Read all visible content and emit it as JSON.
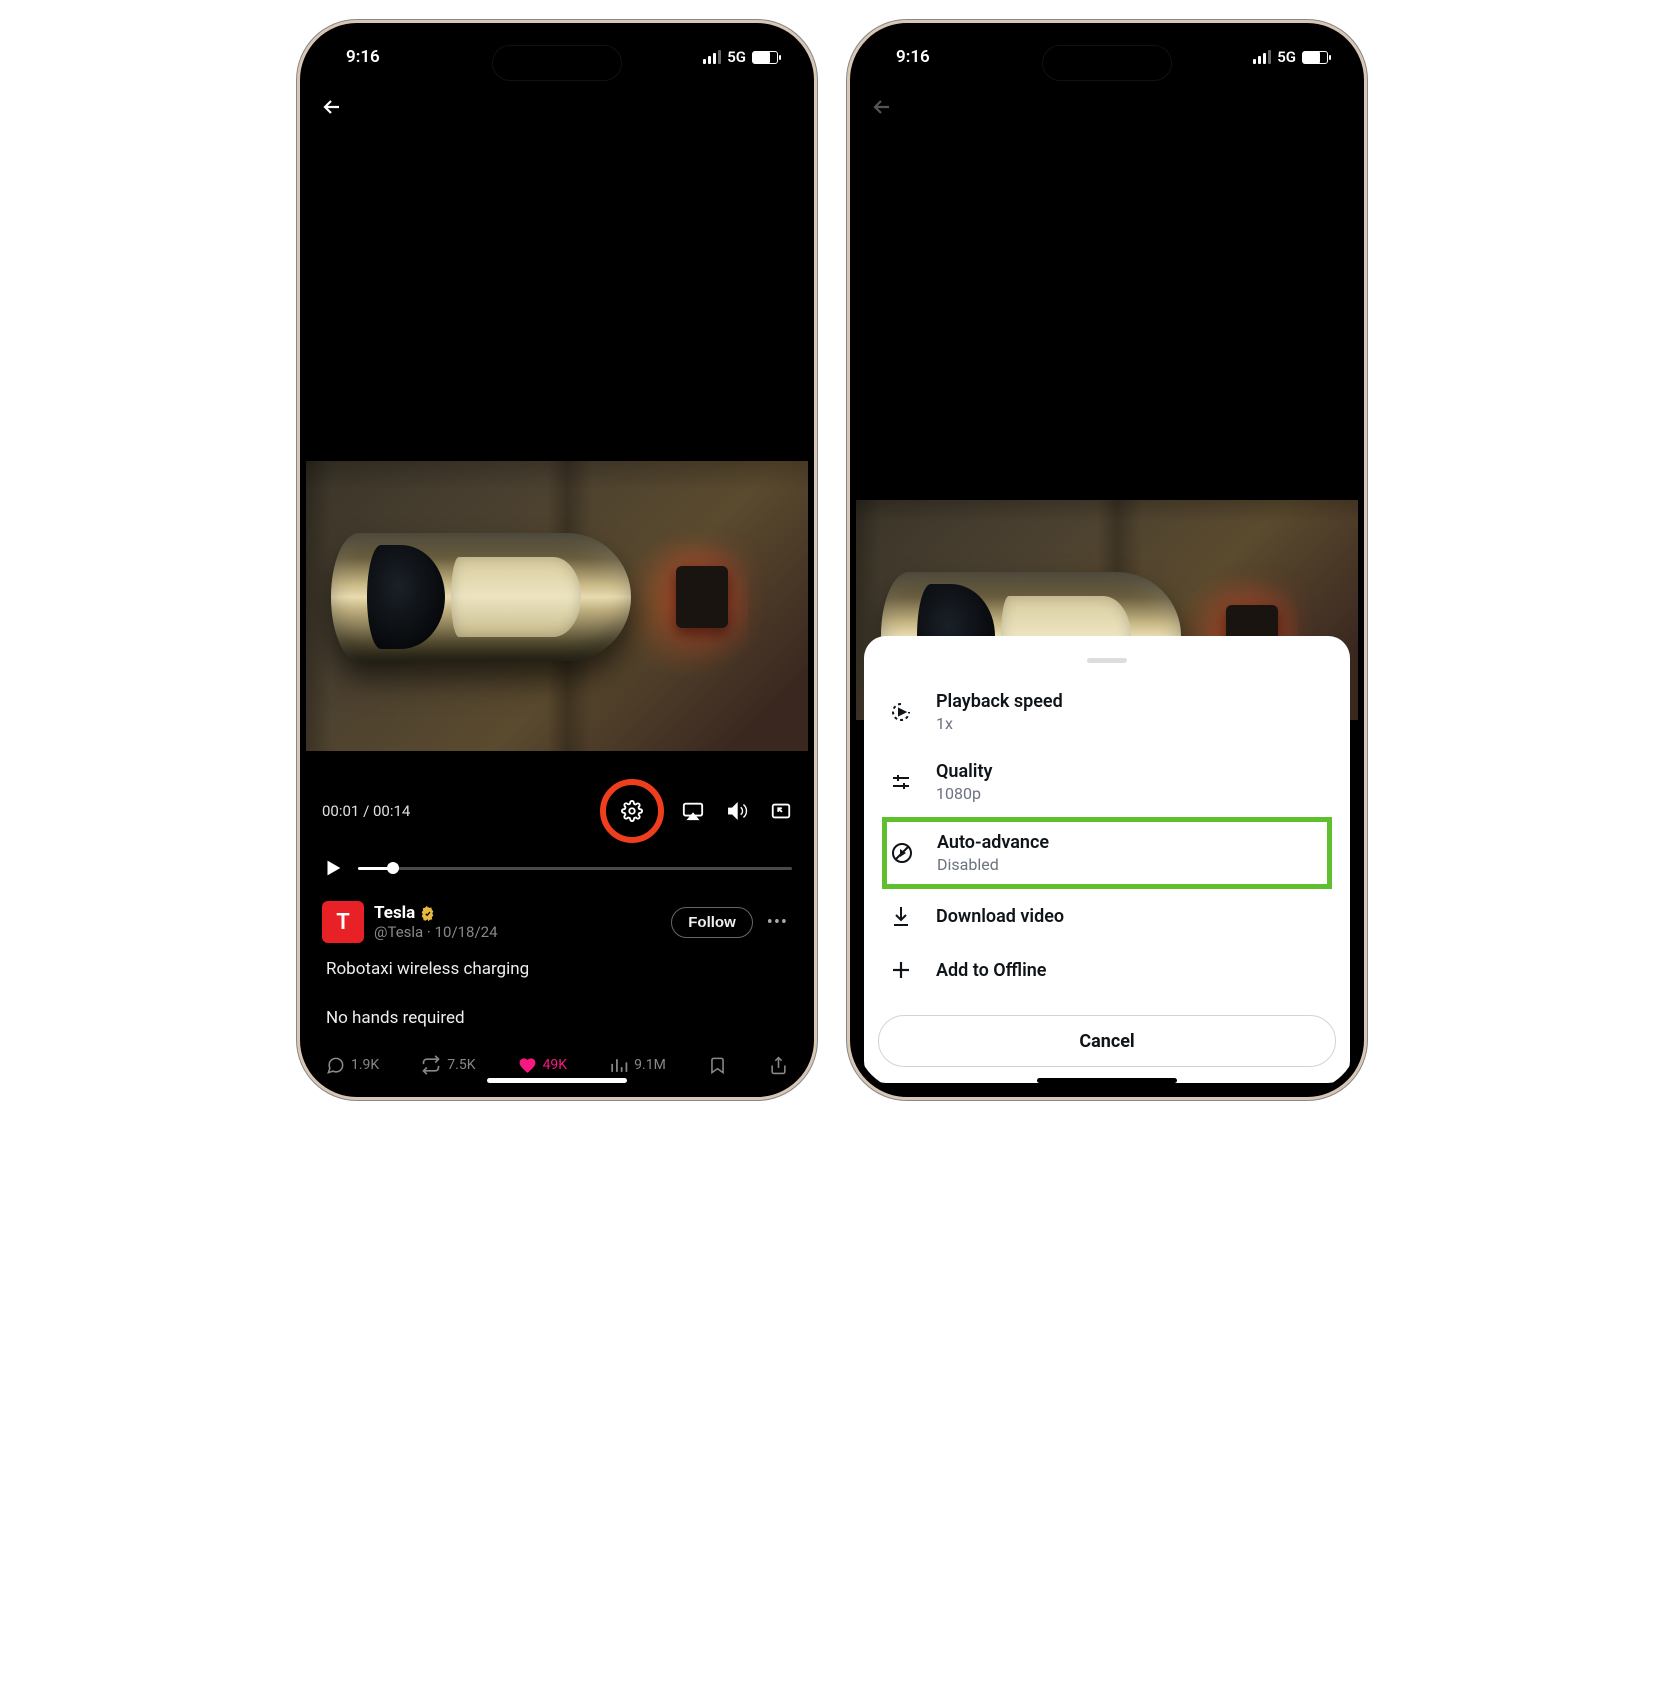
{
  "status": {
    "time": "9:16",
    "network": "5G"
  },
  "video": {
    "current_time": "00:01",
    "duration": "00:14",
    "progress_percent": 8
  },
  "post": {
    "author_name": "Tesla",
    "author_handle": "@Tesla",
    "date": "10/18/24",
    "follow_label": "Follow",
    "text": "Robotaxi wireless charging\n\nNo hands required",
    "avatar_letter": "T"
  },
  "engagement": {
    "replies": "1.9K",
    "retweets": "7.5K",
    "likes": "49K",
    "views": "9.1M"
  },
  "settings_menu": {
    "playback_speed": {
      "title": "Playback speed",
      "value": "1x"
    },
    "quality": {
      "title": "Quality",
      "value": "1080p"
    },
    "auto_advance": {
      "title": "Auto-advance",
      "value": "Disabled"
    },
    "download": {
      "title": "Download video"
    },
    "add_offline": {
      "title": "Add to Offline"
    },
    "cancel": "Cancel"
  }
}
